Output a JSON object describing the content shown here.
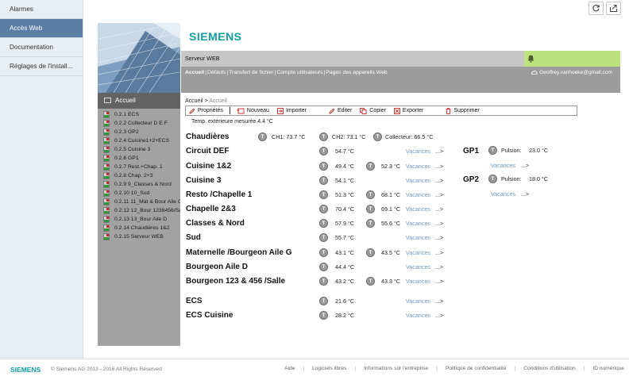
{
  "app_nav": {
    "items": [
      "Alarmes",
      "Accès Web",
      "Documentation",
      "Réglages de l'install..."
    ],
    "active_index": 1
  },
  "toolbar_icons": [
    "refresh-icon",
    "open-external-icon"
  ],
  "brand": {
    "logo": "SIEMENS",
    "accent": "#0e9da0"
  },
  "header": {
    "server_title": "Serveur WEB",
    "nav_links": [
      "Accueil",
      "Défauts",
      "Transfert de fichier",
      "Compte utilisateurs",
      "Pages des appareils Web"
    ],
    "nav_separator": "|",
    "user_email": "Geoffrey.vanhoeke@gmail.com",
    "alarm_bar_color": "#bde37f"
  },
  "tree": {
    "title": "Accueil",
    "items": [
      "0.2.1 ECS",
      "0.2.2 Collecteur D E F",
      "0.2.3 GP2",
      "0.2.4 Cuisine1+2+ECS",
      "0.2.5 Cuisine 3",
      "0.2.6 GP1",
      "0.2.7 Rest.+Chap. 1",
      "0.2.8 Chap. 2+3",
      "0.2.9 9_Classes & Nord",
      "0.2.10 10_Sud",
      "0.2.11 11_Mat & Bour Aile G",
      "0.2.12 12_Bour 1238456/Sa",
      "0.2.13 13_Bour Aile D",
      "0.2.14 Chaudières 1&2",
      "0.2.15 Serveur WEB"
    ]
  },
  "breadcrumb": {
    "root": "Accueil",
    "separator": ">",
    "current": "Accueil"
  },
  "actions": [
    "Propriétés",
    "Nouveau",
    "Importer",
    "Editer",
    "Copier",
    "Exporter",
    "Supprimer"
  ],
  "ext_temp": "Temp. extérieure mesurée  4.4 °C",
  "vacances_label": "Vacances",
  "arrow_label": "...>",
  "chaudieres": {
    "name": "Chaudières",
    "ch1": "CH1: 73.7 °C",
    "ch2": "CH2: 73.1 °C",
    "collecteur": "Collecteur:  66.5 °C"
  },
  "rows": [
    {
      "name": "Circuit DEF",
      "t1": "54.7 °C",
      "t2": ""
    },
    {
      "name": "Cuisine 1&2",
      "t1": "49.4 °C",
      "t2": "52.3 °C"
    },
    {
      "name": "Cuisine 3",
      "t1": "54.1 °C",
      "t2": ""
    },
    {
      "name": "Resto /Chapelle 1",
      "t1": "51.3 °C",
      "t2": "68.1 °C"
    },
    {
      "name": "Chapelle 2&3",
      "t1": "70.4 °C",
      "t2": "69.1 °C"
    },
    {
      "name": "Classes & Nord",
      "t1": "57.9 °C",
      "t2": "55.6 °C"
    },
    {
      "name": "Sud",
      "t1": "55.7 °C",
      "t2": ""
    },
    {
      "name": "Maternelle /Bourgeon Aile G",
      "t1": "43.1 °C",
      "t2": "43.5 °C"
    },
    {
      "name": "Bourgeon Aile D",
      "t1": "44.4 °C",
      "t2": ""
    },
    {
      "name": "Bourgeon 123 & 456 /Salle",
      "t1": "43.2 °C",
      "t2": "43.3 °C"
    },
    {
      "name": "ECS",
      "t1": "21.6 °C",
      "t2": ""
    },
    {
      "name": "ECS Cuisine",
      "t1": "28.2 °C",
      "t2": ""
    }
  ],
  "gp": [
    {
      "name": "GP1",
      "label": "Pulsion:",
      "value": "23.0 °C"
    },
    {
      "name": "GP2",
      "label": "Pulsion:",
      "value": "18.0 °C"
    }
  ],
  "footer": {
    "logo": "SIEMENS",
    "copyright": "© Siemens AG 2013 - 2016 All Rights Reserved",
    "links": [
      "Aide",
      "Logiciels libres",
      "Informations sur l'entreprise",
      "Politique de confidentialité",
      "Conditions d'utilisation",
      "ID numérique"
    ]
  }
}
